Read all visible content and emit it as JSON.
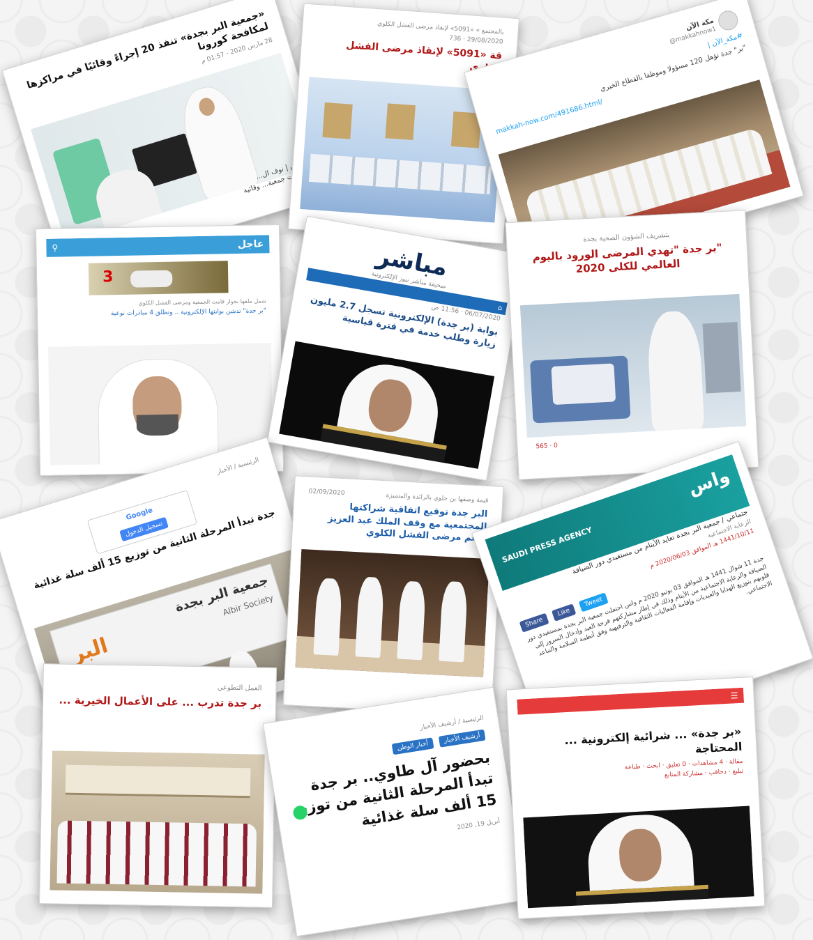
{
  "cards": {
    "c1": {
      "title": "«جمعية البر بجدة» تنفذ 20 إجراءً وقائيًا في مراكزها لمكافحة كورونا",
      "date": "28 مارس 2020 - 01:57 م",
      "excerpt": "الرياض | نوف ال... استشرت جمعية... وقائية للحد..."
    },
    "c2": {
      "breadcrumb": "بالمجتمع » «5091» لإنقاذ مرضى الفشل الكلوي",
      "meta": "29/08/2020 · 736",
      "title": "قة «5091» لإنقاذ مرضى الفشل الكلوي"
    },
    "c3": {
      "account_name": "مكة الآن",
      "handle": "@makkahnow1",
      "hashtag": "#مكة_الآن |",
      "tweet": "\"بر\" جدة تؤهل 120 مسؤولا وموظفا بالقطاع الخيري",
      "link": "makkah-now.com/491686.html/"
    },
    "c4": {
      "site": "عاجل",
      "ad_number": "3",
      "headline1": "شمل ملفها بجوار قامت الجمعية ومرضى الفشل الكلوي",
      "headline2": "\"بر جدة\" تدشن بوابتها الإلكترونية .. وتطلق 4 مبادرات نوعية"
    },
    "c5": {
      "logo": "مباشر",
      "logo_sub": "صحيفة مباشر نيوز الإلكترونية",
      "meta": "06/07/2020 · 11:56 ص",
      "title": "بوابة (بر جدة) الإلكترونية تسجل 2.7 مليون زيارة وطلب خدمة في فترة قياسية"
    },
    "c6": {
      "kicker": "بتشريف الشؤون الصحية بجدة",
      "title": "\"بر جدة \"تهدي المرضى الورود باليوم العالمي للكلى 2020",
      "stats": "565 · 0"
    },
    "c7": {
      "breadcrumb": "الرئيسية / الأخبار",
      "title": "جدة تبدأ المرحلة الثانية من توزيع 15 ألف سلة غذائية",
      "google": "Google",
      "sign_in": "تسجيل الدخول",
      "building_sign": "جمعية البر بجدة",
      "building_sub": "Albir Society",
      "building_brand": "البر"
    },
    "c8": {
      "kicker": "قيمة وصفها بن جلوي بالرائدة والمتميزة",
      "date": "02/09/2020",
      "title": "البر جدة توقيع اتفاقية شراكتها المجتمعية مع وقف الملك عبد العزيز لدعم مرضى الفشل الكلوي"
    },
    "c9": {
      "logo": "واس",
      "logo_en": "SAUDI PRESS AGENCY",
      "breadcrumb": "جتماعي / جمعية البر بجدة تعايد الأيتام من مستفيدي دور الضيافة",
      "category": "الرعاية الاجتماعية",
      "date": "1441/10/11 هـ الموافق 2020/06/03 م",
      "body": "جدة 11 شوال 1441 هـ الموافق 03 يونيو 2020 م واس احتفلت جمعية البر بجدة بمستفيدي دور الضيافة والرعاية الاجتماعية من الأيتام وذلك في إطار مشاركتهم فرحة العيد وإدخال السرور إلى قلوبهم بتوزيع الهدايا والعيديات وإقامة الفعاليات الثقافية والترفيهية وفق أنظمة السلامة والتباعد الاجتماعي.",
      "tweet_btn": "Tweet",
      "like_btn": "Like",
      "share_btn": "Share"
    },
    "c10": {
      "kicker": "العمل التطوعي",
      "title": "بر جدة تدرب ... على الأعمال الخيرية ..."
    },
    "c11": {
      "breadcrumb": "الرئيسية / أرشيف الأخبار",
      "tag1": "أرشيف الأخبار",
      "tag2": "أخبار الوطن",
      "title": "بحضور آل طاوي.. بر جدة تبدأ المرحلة الثانية من توزيع 15 ألف سلة غذائية",
      "date": "أبريل 19, 2020"
    },
    "c12": {
      "title": "«بر جدة» ... شرائية إلكترونية ... المحتاجة",
      "meta": "مقالة · 4 مشاهدات · 0 تعليق · ابحث · طباعة",
      "share_items": "تبليغ · دحاقب · مشاركة المتابع"
    }
  },
  "colors": {
    "card_bg": "#ffffff",
    "page_bg": "#f4f4f4",
    "accent_red": "#b01818",
    "accent_blue": "#2a72c4",
    "spa_teal": "#1a8a8a"
  }
}
